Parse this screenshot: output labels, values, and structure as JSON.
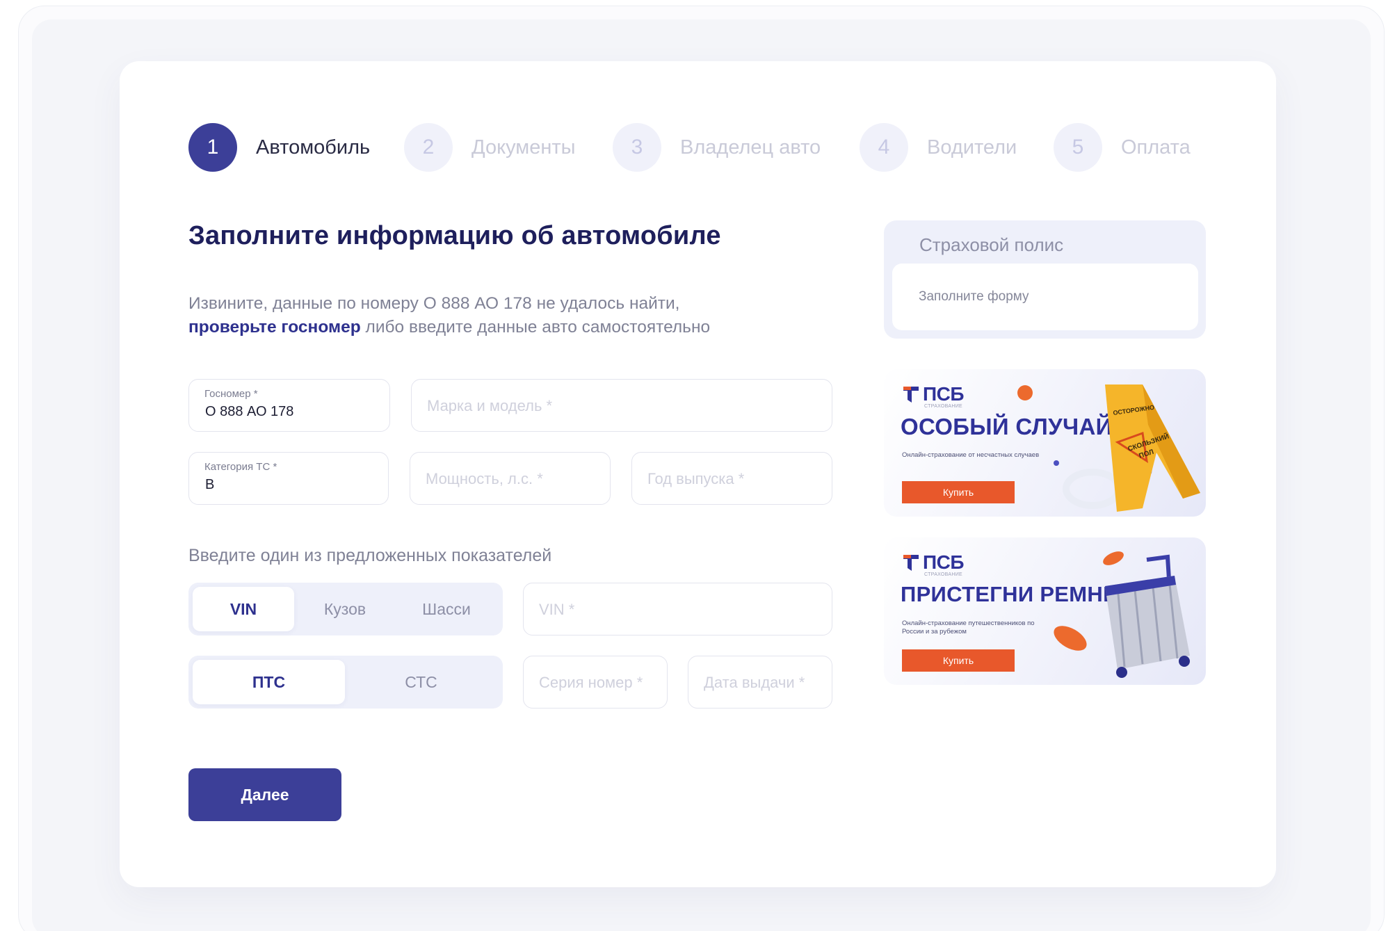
{
  "stepper": {
    "steps": [
      {
        "number": "1",
        "label": "Автомобиль"
      },
      {
        "number": "2",
        "label": "Документы"
      },
      {
        "number": "3",
        "label": "Владелец авто"
      },
      {
        "number": "4",
        "label": "Водители"
      },
      {
        "number": "5",
        "label": "Оплата"
      }
    ],
    "active_step": 1
  },
  "main": {
    "title": "Заполните информацию об автомобиле",
    "notice_text": "Извините, данные по номеру О 888 АО 178 не удалось найти,",
    "notice_link": "проверьте госномер",
    "notice_rest": "либо введите данные авто самостоятельно"
  },
  "fields": {
    "plate": {
      "label": "Госномер *",
      "value": "О 888 АО 178"
    },
    "make_model": {
      "placeholder": "Марка и модель *"
    },
    "category": {
      "label": "Категория ТС *",
      "value": "B"
    },
    "power": {
      "placeholder": "Мощность, л.с. *"
    },
    "year": {
      "placeholder": "Год выпуска *"
    },
    "vin": {
      "placeholder": "VIN *"
    },
    "doc_series": {
      "placeholder": "Серия номер *"
    },
    "doc_date": {
      "placeholder": "Дата выдачи *"
    }
  },
  "identifier": {
    "section_label": "Введите один из предложенных показателей",
    "options": [
      "VIN",
      "Кузов",
      "Шасси"
    ],
    "selected": "VIN"
  },
  "document": {
    "options": [
      "ПТС",
      "СТС"
    ],
    "selected": "ПТС"
  },
  "actions": {
    "next_label": "Далее"
  },
  "policy": {
    "title": "Страховой полис",
    "hint": "Заполните форму"
  },
  "banners": [
    {
      "brand": "ПСБ",
      "brand_sub": "СТРАХОВАНИЕ",
      "headline": "ОСОБЫЙ СЛУЧАЙ",
      "caption": "Онлайн-страхование от несчастных случаев",
      "cta": "Купить",
      "sign_text": "ОСТОРОЖНО СКОЛЬЗКИЙ ПОЛ"
    },
    {
      "brand": "ПСБ",
      "brand_sub": "СТРАХОВАНИЕ",
      "headline": "ПРИСТЕГНИ РЕМНИ",
      "caption": "Онлайн-страхование путешественников по России и за рубежом",
      "cta": "Купить"
    }
  ],
  "colors": {
    "accent": "#3c3f98",
    "heading": "#1e1f5c",
    "muted": "#7f8195",
    "cta_orange": "#e8582b",
    "soft_bg": "#eef0fa"
  }
}
